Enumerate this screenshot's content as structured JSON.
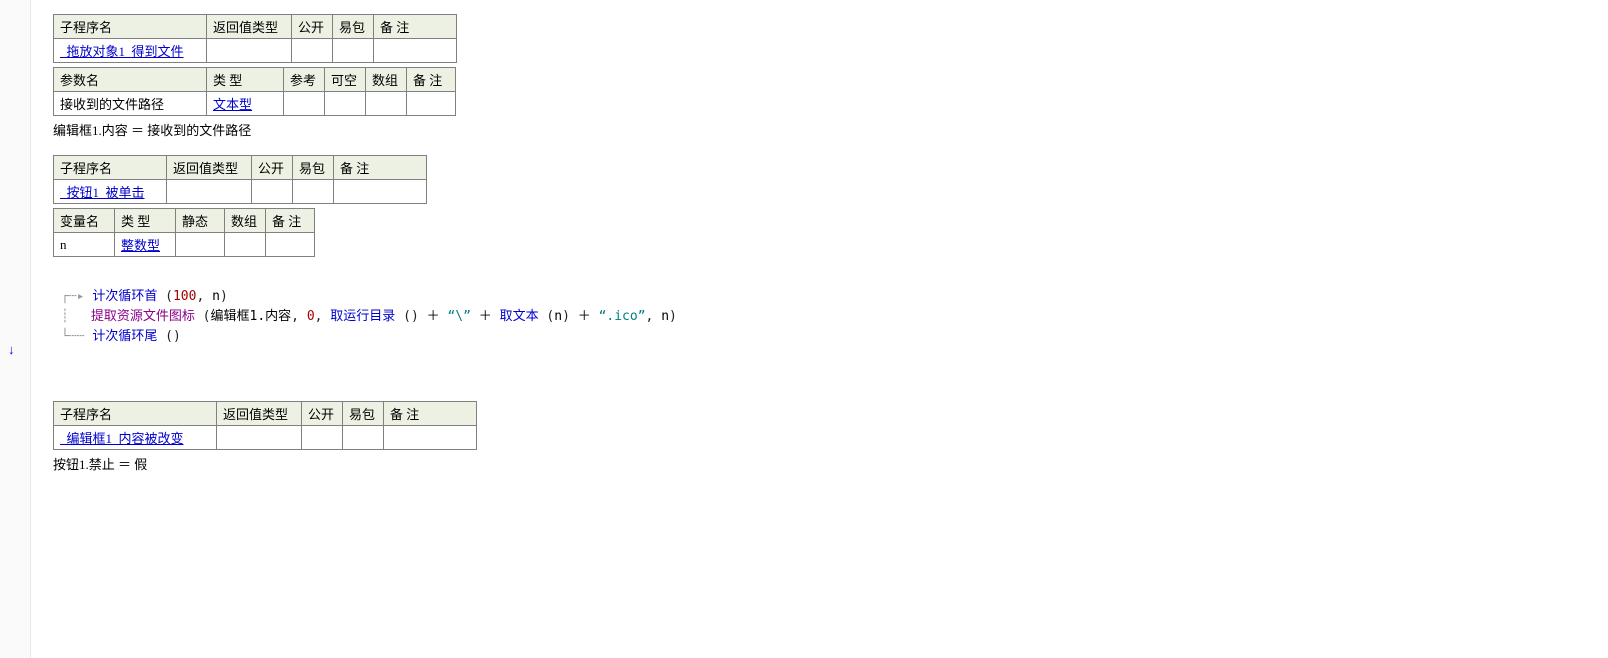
{
  "gutter": {
    "arrow_glyph": "↓"
  },
  "sub1": {
    "headers": {
      "name": "子程序名",
      "ret": "返回值类型",
      "pub": "公开",
      "pack": "易包",
      "remark": "备 注"
    },
    "name": "_拖放对象1_得到文件",
    "ret": "",
    "pub": "",
    "pack": "",
    "remark": ""
  },
  "params1": {
    "headers": {
      "name": "参数名",
      "type": "类 型",
      "ref": "参考",
      "nullable": "可空",
      "array": "数组",
      "remark": "备 注"
    },
    "row": {
      "name": "接收到的文件路径",
      "type": "文本型",
      "ref": "",
      "nullable": "",
      "array": "",
      "remark": ""
    }
  },
  "stmt1": "编辑框1.内容 ＝ 接收到的文件路径",
  "sub2": {
    "headers": {
      "name": "子程序名",
      "ret": "返回值类型",
      "pub": "公开",
      "pack": "易包",
      "remark": "备 注"
    },
    "name": "_按钮1_被单击",
    "ret": "",
    "pub": "",
    "pack": "",
    "remark": ""
  },
  "vars2": {
    "headers": {
      "name": "变量名",
      "type": "类 型",
      "static": "静态",
      "array": "数组",
      "remark": "备 注"
    },
    "row": {
      "name": "n",
      "type": "整数型",
      "static": "",
      "array": "",
      "remark": ""
    }
  },
  "code": {
    "guide_top": "┌┄▸",
    "guide_mid": "┊",
    "guide_bot": "└┄┄",
    "loop_head": "计次循环首",
    "loop_head_args_a": "100",
    "loop_head_args_b": "n",
    "call_name": "提取资源文件图标",
    "call_arg1": "编辑框1.内容",
    "call_arg2": "0",
    "call_fn_run": "取运行目录",
    "call_lit_slash": "“\\”",
    "call_fn_txt": "取文本",
    "call_txt_arg": "n",
    "call_lit_ico": "“.ico”",
    "call_last": "n",
    "loop_tail": "计次循环尾"
  },
  "sub3": {
    "headers": {
      "name": "子程序名",
      "ret": "返回值类型",
      "pub": "公开",
      "pack": "易包",
      "remark": "备 注"
    },
    "name": "_编辑框1_内容被改变",
    "ret": "",
    "pub": "",
    "pack": "",
    "remark": ""
  },
  "stmt3": "按钮1.禁止 ＝ 假"
}
